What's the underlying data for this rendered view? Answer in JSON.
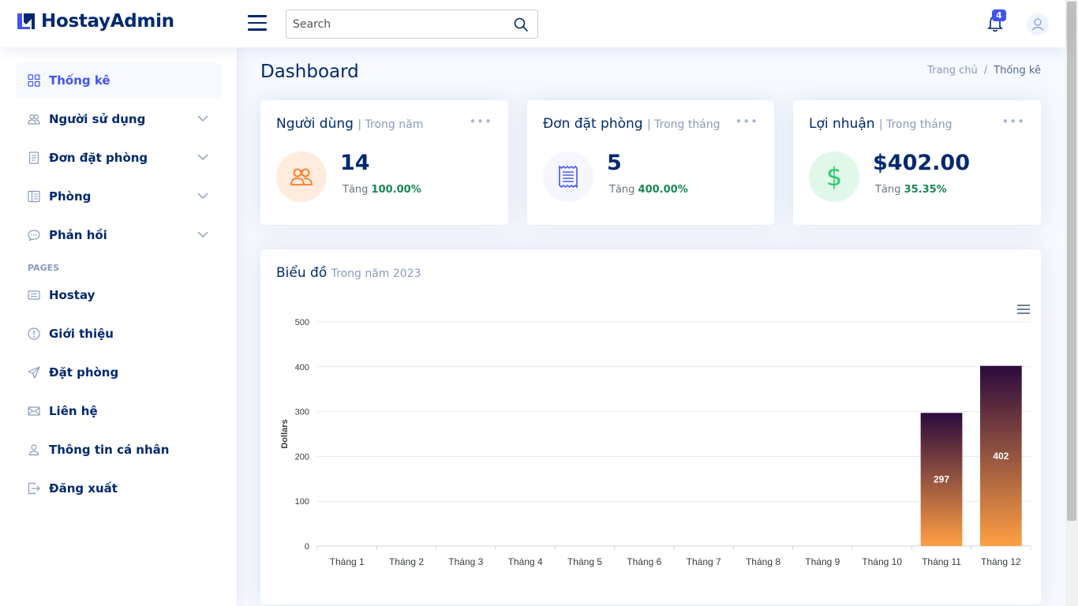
{
  "header": {
    "app_name": "HostayAdmin",
    "search_placeholder": "Search",
    "notification_count": "4"
  },
  "sidebar": {
    "items": [
      {
        "label": "Thống kê",
        "icon": "grid-icon"
      },
      {
        "label": "Người sử dụng",
        "icon": "people-icon"
      },
      {
        "label": "Đơn đặt phòng",
        "icon": "receipt-icon"
      },
      {
        "label": "Phòng",
        "icon": "layout-icon"
      },
      {
        "label": "Phản hồi",
        "icon": "chat-icon"
      }
    ],
    "pages_heading": "PAGES",
    "pages": [
      {
        "label": "Hostay",
        "icon": "card-icon"
      },
      {
        "label": "Giới thiệu",
        "icon": "info-icon"
      },
      {
        "label": "Đặt phòng",
        "icon": "send-icon"
      },
      {
        "label": "Liên hệ",
        "icon": "envelope-icon"
      },
      {
        "label": "Thông tin cá nhân",
        "icon": "person-icon"
      },
      {
        "label": "Đăng xuất",
        "icon": "logout-icon"
      }
    ]
  },
  "main": {
    "title": "Dashboard",
    "breadcrumb": {
      "home": "Trang chủ",
      "sep": "/",
      "current": "Thống kê"
    }
  },
  "cards": [
    {
      "title": "Người dùng",
      "sub": "| Trong năm",
      "value": "14",
      "change_label": "Tăng",
      "change_pct": "100.00%",
      "icon": "people-icon",
      "icon_bg": "#ffecdf",
      "icon_color": "#ff771d"
    },
    {
      "title": "Đơn đặt phòng",
      "sub": "| Trong tháng",
      "value": "5",
      "change_label": "Tăng",
      "change_pct": "400.00%",
      "icon": "receipt-icon",
      "icon_bg": "#f6f6fe",
      "icon_color": "#4154f1"
    },
    {
      "title": "Lợi nhuận",
      "sub": "| Trong tháng",
      "value": "$402.00",
      "change_label": "Tăng",
      "change_pct": "35.35%",
      "icon": "dollar-icon",
      "icon_bg": "#e0f8e9",
      "icon_color": "#2eca6a"
    }
  ],
  "chart": {
    "title": "Biểu đồ",
    "sub": "Trong năm 2023"
  },
  "chart_data": {
    "type": "bar",
    "categories": [
      "Tháng 1",
      "Tháng 2",
      "Tháng 3",
      "Tháng 4",
      "Tháng 5",
      "Tháng 6",
      "Tháng 7",
      "Tháng 8",
      "Tháng 9",
      "Tháng 10",
      "Tháng 11",
      "Tháng 12"
    ],
    "values": [
      0,
      0,
      0,
      0,
      0,
      0,
      0,
      0,
      0,
      0,
      297,
      402
    ],
    "data_labels": [
      "",
      "",
      "",
      "",
      "",
      "",
      "",
      "",
      "",
      "",
      "297",
      "402"
    ],
    "ylabel": "Dollars",
    "xlabel": "",
    "ylim": [
      0,
      500
    ],
    "yticks": [
      0,
      100,
      200,
      300,
      400,
      500
    ],
    "grid": true,
    "bar_gradient": [
      "#2b0a3d",
      "#ff9f43"
    ]
  }
}
